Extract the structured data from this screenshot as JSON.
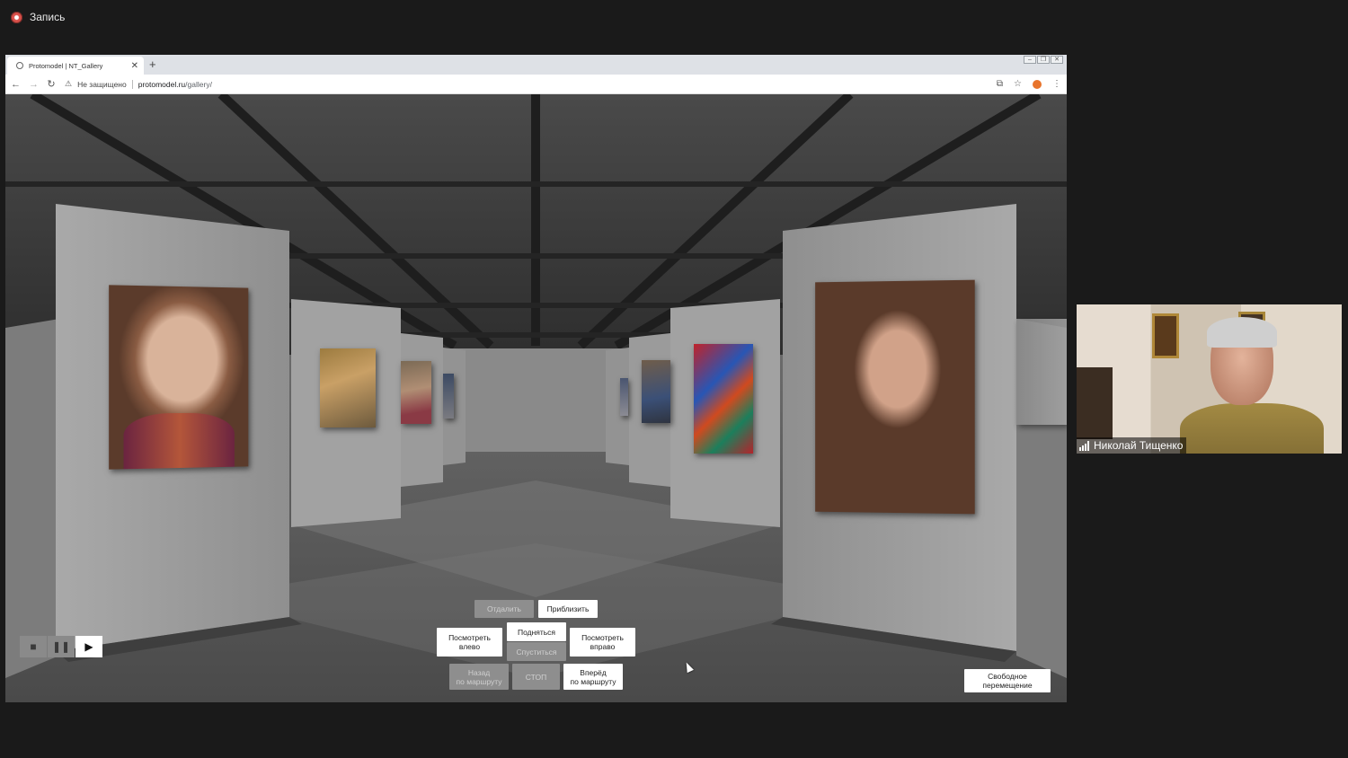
{
  "recording": {
    "label": "Запись"
  },
  "browser": {
    "tab_title": "Protomodel | NT_Gallery",
    "new_tab": "+",
    "security_text": "Не защищено",
    "url_host": "protomodel.ru",
    "url_path": "/gallery/"
  },
  "gallery": {
    "controls": {
      "zoom_out": "Отдалить",
      "zoom_in": "Приблизить",
      "look_left": "Посмотреть\nвлево",
      "rise": "Подняться",
      "descend": "Спуститься",
      "look_right": "Посмотреть\nвправо",
      "back_route": "Назад\nпо маршруту",
      "stop": "СТОП",
      "forward_route": "Вперёд\nпо маршруту",
      "free_move": "Свободное\nперемещение"
    },
    "media": {
      "stop": "■",
      "pause": "❚❚",
      "play": "▶"
    }
  },
  "participant": {
    "name": "Николай Тищенко"
  },
  "colors": {
    "accent_rec": "#d8504a",
    "scene_gray": "#6e6e6e",
    "button_active": "#ffffff",
    "button_disabled": "#8e8e8e"
  }
}
